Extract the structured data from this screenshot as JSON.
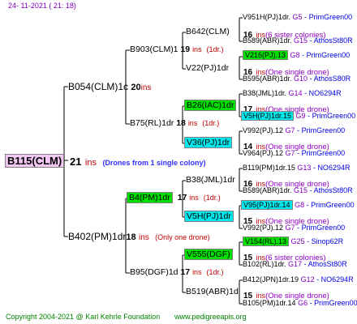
{
  "header": {
    "date": "24- 11-2021 ( 21: 18)"
  },
  "footer": {
    "copyright": "Copyright 2004-2021 @ Karl Kehrle Foundation",
    "site": "www.pedigreeapis.org"
  },
  "root": {
    "name": "B115(CLM)",
    "num": "21",
    "ins": "ins",
    "note": "(Drones from 1 single colony)"
  },
  "sire": {
    "name": "B054(CLM)1c",
    "num": "20",
    "ins": "ins"
  },
  "mother": {
    "name": "B402(PM)1dr",
    "num": "18",
    "ins": "ins",
    "note": "(Only one drone)"
  },
  "ss": {
    "name": "B903(CLM)1",
    "num": "19",
    "ins": "ins",
    "note": "(1dr.)"
  },
  "sd": {
    "name": "B75(RL)1dr",
    "num": "18",
    "ins": "ins",
    "note": "(1dr.)"
  },
  "ms": {
    "name": "B4(PM)1dr",
    "num": "17",
    "ins": "ins",
    "note": "(1dr.)"
  },
  "md": {
    "name": "B95(DGF)1d",
    "num": "17",
    "ins": "ins",
    "note": "(1dr.)"
  },
  "g": [
    {
      "name": "B642(CLM)",
      "num": "16",
      "ins": "ins",
      "note": "(6 sister colonies)"
    },
    {
      "name": "V22(PJ)1dr",
      "num": "16",
      "ins": "ins",
      "note": "(One single drone)"
    },
    {
      "name": "B26(IAC)1dr",
      "num": "17",
      "ins": "ins",
      "note": "(One single drone)"
    },
    {
      "name": "V36(PJ)1dr",
      "num": "14",
      "ins": "ins",
      "note": "(One single drone)"
    },
    {
      "name": "B38(JML)1dr",
      "num": "16",
      "ins": "ins",
      "note": "(One single drone)"
    },
    {
      "name": "V5H(PJ)1dr",
      "num": "15",
      "ins": "ins",
      "note": "(One single drone)"
    },
    {
      "name": "V555(DGF)",
      "num": "15",
      "ins": "ins",
      "note": "(6 sister colonies)"
    },
    {
      "name": "B519(ABR)1d",
      "num": "15",
      "ins": "ins",
      "note": "(One single drone)"
    }
  ],
  "anc": [
    {
      "name": "V951H(PJ)1dr.",
      "s": "G5",
      "p": "PrimGreen00"
    },
    {
      "name": "B589(ABR)1dr.",
      "s": "G15",
      "p": "AthosSt80R"
    },
    {
      "name": "V216(PJ).13",
      "s": "G8",
      "p": "PrimGreen00"
    },
    {
      "name": "B595(ABR)1dr.",
      "s": "G10",
      "p": "AthosS80R"
    },
    {
      "name": "B38(JML)1dr.",
      "s": "G14",
      "p": "NO6294R"
    },
    {
      "name": "V5H(PJ)1dr.15",
      "s": "G9",
      "p": "PrimGreen00"
    },
    {
      "name": "V992(PJ).12",
      "s": "G7",
      "p": "PrimGreen00"
    },
    {
      "name": "V964(PJ).12",
      "s": "G7",
      "p": "PrimGreen00"
    },
    {
      "name": "B119(PM)1dr.15",
      "s": "G13",
      "p": "NO6294R"
    },
    {
      "name": "B589(ABR)1dr.",
      "s": "G15",
      "p": "AthosSt80R"
    },
    {
      "name": "V95(PJ)1dr.14",
      "s": "G8",
      "p": "PrimGreen00"
    },
    {
      "name": "V992(PJ).12",
      "s": "G7",
      "p": "PrimGreen00"
    },
    {
      "name": "V154(RL).13",
      "s": "G25",
      "p": "Sinop62R"
    },
    {
      "name": "B102(RL)1dr.",
      "s": "G17",
      "p": "AthosSt80R"
    },
    {
      "name": "B412(JPN)1dr.19",
      "s": "G12",
      "p": "NO6294R"
    },
    {
      "name": "B105(PM)1dr.14",
      "s": "G6",
      "p": "PrimGreen00"
    }
  ]
}
